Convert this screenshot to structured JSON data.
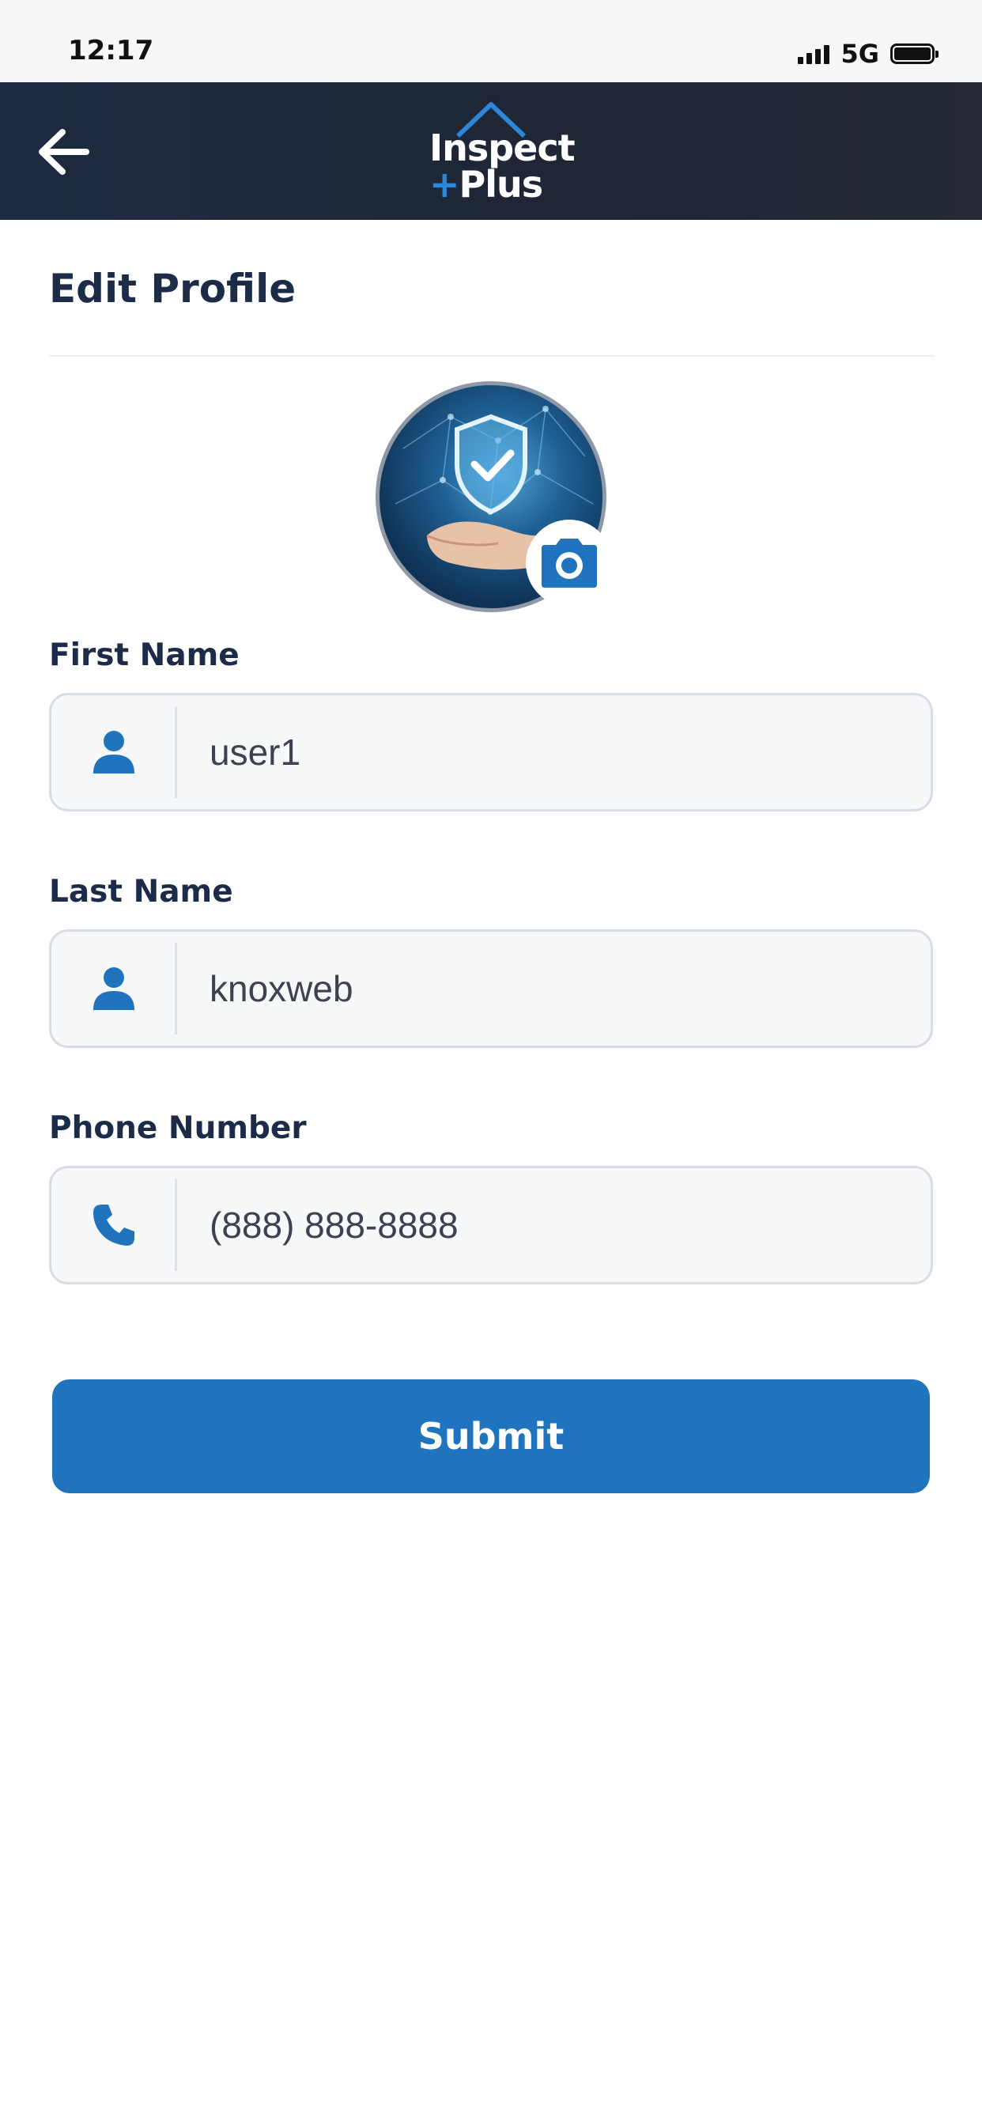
{
  "status_bar": {
    "time": "12:17",
    "network": "5G",
    "icons": [
      "signal-icon",
      "battery-icon"
    ]
  },
  "header": {
    "back_icon": "arrow-left-icon",
    "logo": {
      "line1": "Inspect",
      "plus_sign": "+",
      "line2": "Plus"
    }
  },
  "page": {
    "title": "Edit Profile"
  },
  "avatar": {
    "camera_icon": "camera-icon"
  },
  "form": {
    "first_name": {
      "label": "First Name",
      "value": "user1",
      "icon": "person-icon"
    },
    "last_name": {
      "label": "Last Name",
      "value": "knoxweb",
      "icon": "person-icon"
    },
    "phone": {
      "label": "Phone Number",
      "value": "(888) 888-8888",
      "icon": "phone-icon"
    },
    "submit_label": "Submit"
  },
  "colors": {
    "header_bg": "#1f2634",
    "accent": "#1f74bd",
    "title_text": "#1c2b48",
    "field_bg": "#f6f8fa",
    "field_border": "#d7dde6"
  }
}
